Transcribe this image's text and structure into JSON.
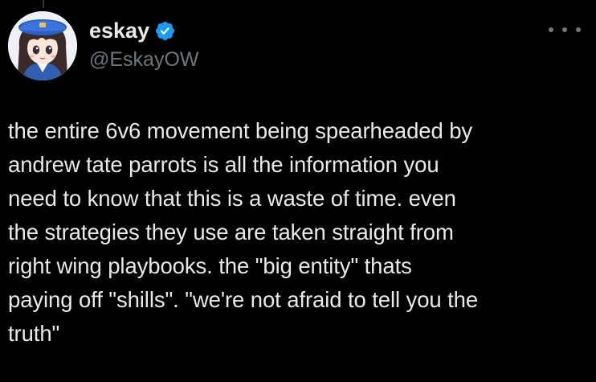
{
  "author": {
    "display_name": "eskay",
    "handle": "@EskayOW",
    "verified": true,
    "avatar_icon": "anime-avatar-icon",
    "verified_icon": "verified-badge-icon"
  },
  "menu": {
    "icon": "more-options-icon"
  },
  "post": {
    "text": "the entire 6v6 movement being spearheaded by\nandrew tate parrots is all the information you\nneed to know that this is a waste of time. even\nthe strategies they use are taken straight from\nright wing playbooks. the \"big entity\" thats\npaying off \"shills\". \"we're not afraid to tell you the\ntruth\""
  },
  "colors": {
    "background": "#000000",
    "primary_text": "#e7e9ea",
    "secondary_text": "#71767b",
    "verified_blue": "#1d9bf0"
  }
}
